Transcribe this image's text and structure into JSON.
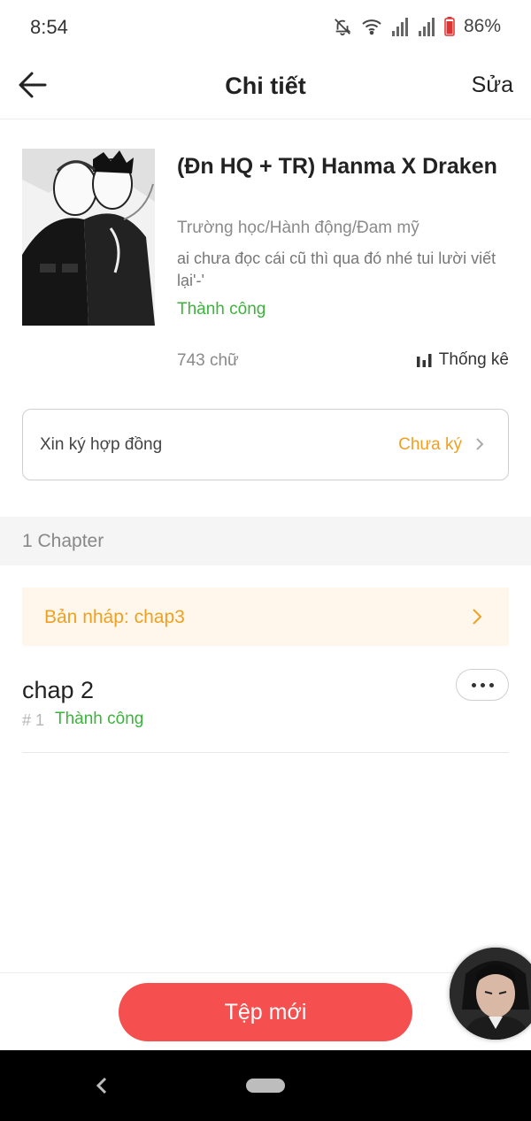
{
  "status_bar": {
    "time": "8:54",
    "battery": "86%",
    "icons": [
      "mute-bell-icon",
      "wifi-icon",
      "signal-icon",
      "signal-icon",
      "battery-icon"
    ]
  },
  "header": {
    "title": "Chi tiết",
    "edit_label": "Sửa",
    "back_icon": "arrow-left-icon"
  },
  "book": {
    "title": "(Đn HQ + TR) Hanma X Draken",
    "genre": "Trường học/Hành động/Đam mỹ",
    "description": "ai chưa đọc cái cũ thì qua đó nhé tui lười viết lại'-'",
    "status": "Thành công",
    "word_count": "743 chữ",
    "stats_label": "Thống kê",
    "stats_icon": "bar-chart-icon"
  },
  "contract": {
    "label": "Xin ký hợp đồng",
    "status": "Chưa ký"
  },
  "chapters": {
    "count_label": "1 Chapter",
    "draft_label": "Bản nháp: chap3",
    "items": [
      {
        "name": "chap 2",
        "index": "# 1",
        "status": "Thành công"
      }
    ]
  },
  "bottom": {
    "new_file_label": "Tệp mới"
  },
  "colors": {
    "accent_red": "#f54f4f",
    "success_green": "#3cb43c",
    "warning_orange": "#f0a020",
    "draft_bg": "#fff7eb"
  }
}
